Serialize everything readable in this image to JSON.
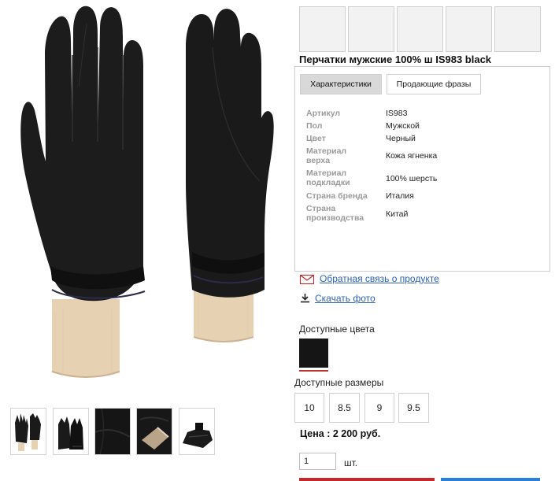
{
  "product": {
    "title": "Перчатки мужские 100% ш IS983 black",
    "main_image_icon": "glove-on-wooden-stand",
    "thumbnails": [
      {
        "icon": "glove-pair-thumbnail"
      },
      {
        "icon": "glove-pair-side-thumbnail"
      },
      {
        "icon": "leather-closeup-thumbnail"
      },
      {
        "icon": "lining-detail-thumbnail"
      },
      {
        "icon": "glove-cuff-detail-thumbnail"
      }
    ],
    "placeholder_count": 5
  },
  "tabs": [
    {
      "label": "Характеристики",
      "active": true
    },
    {
      "label": "Продающие фразы",
      "active": false
    }
  ],
  "specs": [
    {
      "label": "Артикул",
      "value": "IS983"
    },
    {
      "label": "Пол",
      "value": "Мужской"
    },
    {
      "label": "Цвет",
      "value": "Черный"
    },
    {
      "label": "Материал верха",
      "value": "Кожа ягненка"
    },
    {
      "label": "Материал подкладки",
      "value": "100% шерсть"
    },
    {
      "label": "Страна бренда",
      "value": "Италия"
    },
    {
      "label": "Страна производства",
      "value": "Китай"
    }
  ],
  "links": {
    "feedback": "Обратная связь о продукте",
    "download": "Скачать фото"
  },
  "colors": {
    "label": "Доступные цвета",
    "swatch": "#151515",
    "selected_underline": "#c0392b"
  },
  "sizes": {
    "label": "Доступные размеры",
    "options": [
      "10",
      "8.5",
      "9",
      "9.5"
    ]
  },
  "price": "Цена : 2 200 руб.",
  "quantity": {
    "value": "1",
    "unit": "шт."
  },
  "accent_colors": {
    "link": "#2a62b8",
    "primary_button": "#c62828",
    "secondary_button": "#2980d9"
  }
}
